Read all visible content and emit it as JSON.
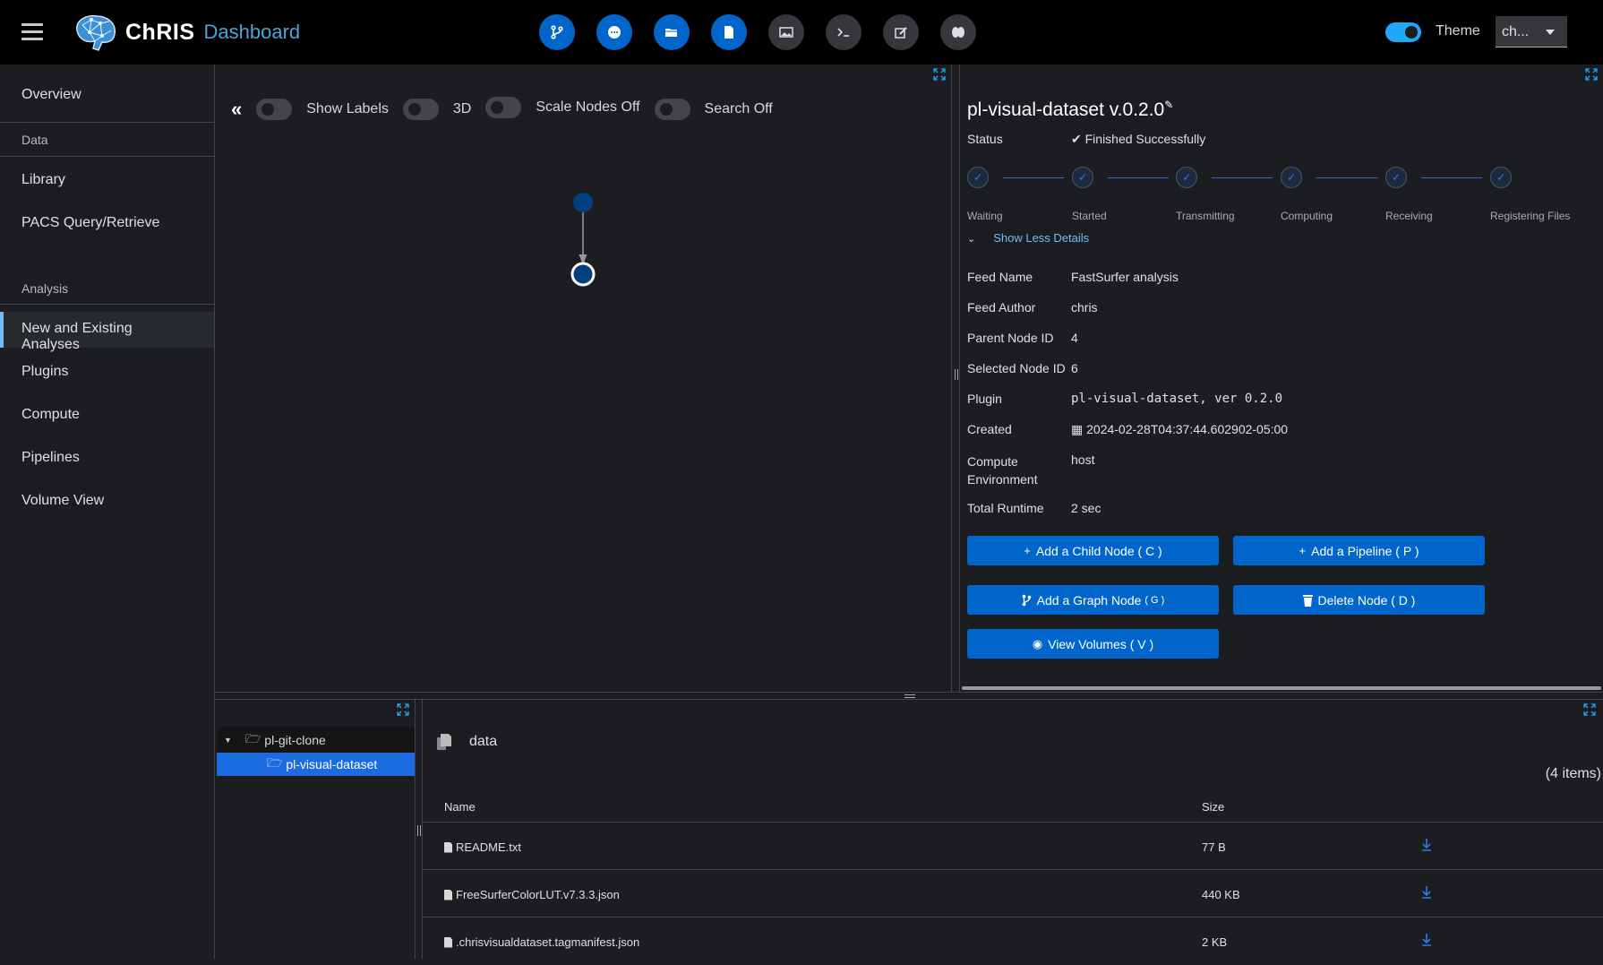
{
  "header": {
    "brand_name": "ChRIS",
    "brand_suffix": "Dashboard",
    "toolbar_icons": [
      "graph-node-icon",
      "more-dots-icon",
      "folder-open-icon",
      "file-icon",
      "image-icon",
      "terminal-icon",
      "edit-icon",
      "brain-icon"
    ],
    "theme_label": "Theme",
    "theme_value": "ch...",
    "theme_toggle_on": true
  },
  "sidebar": {
    "items": [
      {
        "label": "Overview"
      },
      {
        "label": "Library"
      },
      {
        "label": "PACS Query/Retrieve"
      },
      {
        "label": "New and Existing Analyses",
        "active": true
      },
      {
        "label": "Plugins"
      },
      {
        "label": "Compute"
      },
      {
        "label": "Pipelines"
      },
      {
        "label": "Volume View"
      }
    ],
    "sections": [
      "Data",
      "Analysis"
    ]
  },
  "graph": {
    "controls": [
      {
        "label": "Show Labels",
        "on": false
      },
      {
        "label": "3D",
        "on": false
      },
      {
        "label": "Scale Nodes Off",
        "on": false
      },
      {
        "label": "Search Off",
        "on": false
      }
    ],
    "node_color": "#004080"
  },
  "details": {
    "title": "pl-visual-dataset v.0.2.0",
    "status_label": "Status",
    "status_value": "Finished Successfully",
    "steps": [
      "Waiting",
      "Started",
      "Transmitting",
      "Computing",
      "Receiving",
      "Registering Files"
    ],
    "toggle_label": "Show Less Details",
    "fields": [
      {
        "key": "Feed Name",
        "value": "FastSurfer analysis"
      },
      {
        "key": "Feed Author",
        "value": "chris"
      },
      {
        "key": "Parent Node ID",
        "value": "4"
      },
      {
        "key": "Selected Node ID",
        "value": "6"
      },
      {
        "key": "Plugin",
        "value": "pl-visual-dataset, ver 0.2.0"
      },
      {
        "key": "Created",
        "value": "2024-02-28T04:37:44.602902-05:00"
      },
      {
        "key": "Compute Environment",
        "value": "host"
      },
      {
        "key": "Total Runtime",
        "value": "2 sec"
      }
    ],
    "buttons": {
      "add_child": "Add a Child Node ( C )",
      "add_pipeline": "Add a Pipeline ( P )",
      "add_graph": "Add a Graph Node",
      "add_graph_key": "( G )",
      "delete": "Delete Node ( D )",
      "view_volumes": "View Volumes ( V )"
    },
    "accent": "#0066cc"
  },
  "tree": {
    "items": [
      {
        "label": "pl-git-clone",
        "expanded": true
      },
      {
        "label": "pl-visual-dataset",
        "selected": true
      }
    ]
  },
  "files": {
    "folder": "data",
    "count_label": "(4 items)",
    "columns": [
      "Name",
      "Size"
    ],
    "rows": [
      {
        "name": "README.txt",
        "size": "77 B"
      },
      {
        "name": "FreeSurferColorLUT.v7.3.3.json",
        "size": "440 KB"
      },
      {
        "name": ".chrisvisualdataset.tagmanifest.json",
        "size": "2 KB"
      }
    ]
  }
}
